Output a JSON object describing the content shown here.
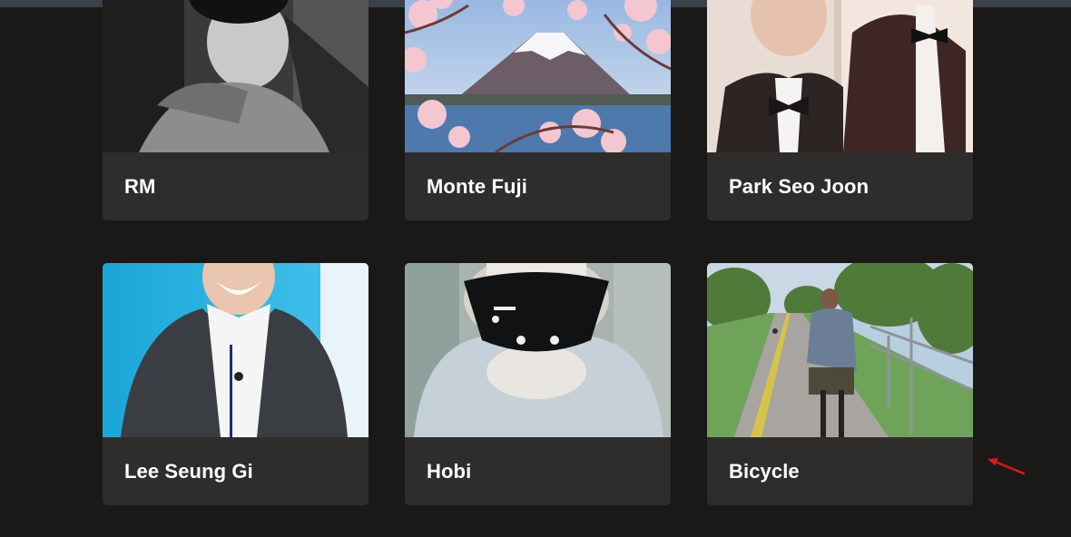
{
  "gallery": {
    "cards": [
      {
        "title": "RM",
        "image": "grayscale-portrait-hoodie"
      },
      {
        "title": "Monte Fuji",
        "image": "mount-fuji-cherry-blossoms"
      },
      {
        "title": "Park Seo Joon",
        "image": "man-in-tuxedo-bowtie"
      },
      {
        "title": "Lee Seung Gi",
        "image": "smiling-man-in-suit"
      },
      {
        "title": "Hobi",
        "image": "person-wearing-black-mask"
      },
      {
        "title": "Bicycle",
        "image": "cyclist-on-park-path"
      }
    ]
  },
  "annotation": {
    "icon": "red-arrow-icon",
    "color": "#e0161b"
  },
  "colors": {
    "background": "#1b1918",
    "card": "#2f2d2b",
    "text": "#ffffff",
    "topbar": "#3b414a"
  }
}
